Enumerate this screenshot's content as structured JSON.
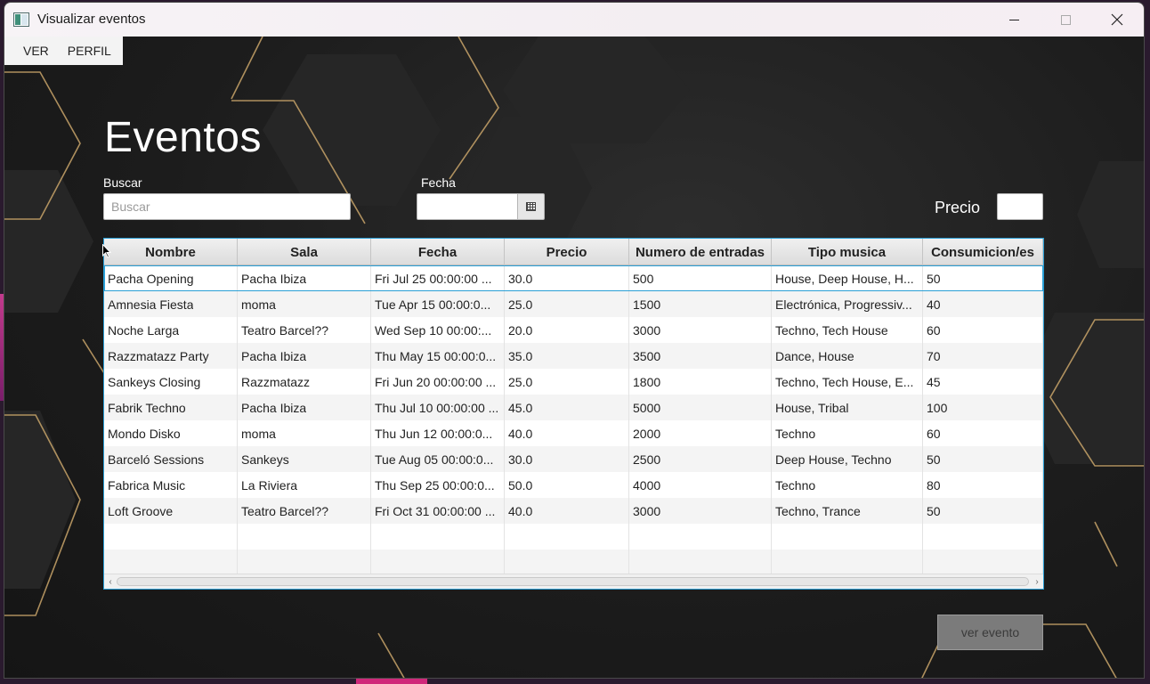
{
  "window": {
    "title": "Visualizar eventos",
    "controls": [
      "minimize",
      "maximize",
      "close"
    ]
  },
  "menubar": {
    "items": [
      {
        "label": "VER"
      },
      {
        "label": "PERFIL"
      }
    ]
  },
  "page": {
    "title": "Eventos"
  },
  "filters": {
    "search_label": "Buscar",
    "search_placeholder": "Buscar",
    "search_value": "",
    "date_label": "Fecha",
    "date_value": "",
    "price_label": "Precio",
    "price_value": ""
  },
  "table": {
    "columns": [
      "Nombre",
      "Sala",
      "Fecha",
      "Precio",
      "Numero de entradas",
      "Tipo musica",
      "Consumicion/es"
    ],
    "rows": [
      [
        "Pacha Opening",
        "Pacha Ibiza",
        "Fri Jul 25 00:00:00 ...",
        "30.0",
        "500",
        "House, Deep House, H...",
        "50"
      ],
      [
        "Amnesia Fiesta",
        "moma",
        "Tue Apr 15 00:00:0...",
        "25.0",
        "1500",
        "Electrónica, Progressiv...",
        "40"
      ],
      [
        "Noche Larga",
        "Teatro Barcel??",
        "Wed Sep 10 00:00:...",
        "20.0",
        "3000",
        "Techno, Tech House",
        "60"
      ],
      [
        "Razzmatazz Party",
        "Pacha Ibiza",
        "Thu May 15 00:00:0...",
        "35.0",
        "3500",
        "Dance, House",
        "70"
      ],
      [
        "Sankeys Closing",
        "Razzmatazz",
        "Fri Jun 20 00:00:00 ...",
        "25.0",
        "1800",
        "Techno, Tech House, E...",
        "45"
      ],
      [
        "Fabrik Techno",
        "Pacha Ibiza",
        "Thu Jul 10 00:00:00 ...",
        "45.0",
        "5000",
        "House, Tribal",
        "100"
      ],
      [
        "Mondo Disko",
        "moma",
        "Thu Jun 12 00:00:0...",
        "40.0",
        "2000",
        "Techno",
        "60"
      ],
      [
        "Barceló Sessions",
        "Sankeys",
        "Tue Aug 05 00:00:0...",
        "30.0",
        "2500",
        "Deep House, Techno",
        "50"
      ],
      [
        "Fabrica Music",
        "La Riviera",
        "Thu Sep 25 00:00:0...",
        "50.0",
        "4000",
        "Techno",
        "80"
      ],
      [
        "Loft Groove",
        "Teatro Barcel??",
        "Fri Oct 31 00:00:00 ...",
        "40.0",
        "3000",
        "Techno, Trance",
        "50"
      ]
    ],
    "selected_row": 0
  },
  "actions": {
    "ver_evento_label": "ver evento"
  },
  "colors": {
    "accent": "#2a9fd6",
    "gold_lines": "#c9a56a",
    "background": "#1f1f1f"
  }
}
